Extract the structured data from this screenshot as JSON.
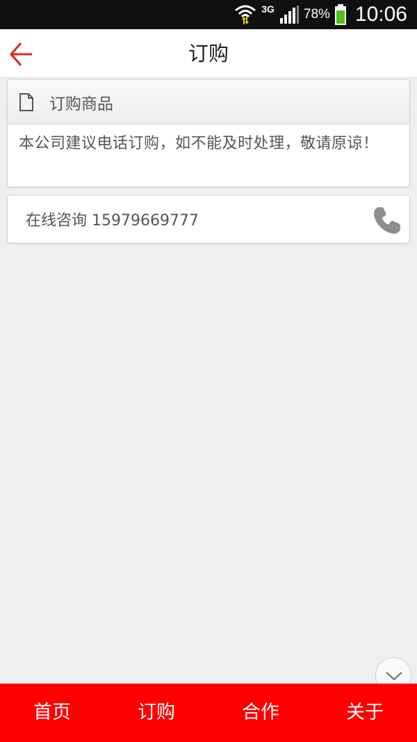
{
  "status_bar": {
    "network": "3G",
    "battery": "78%",
    "time": "10:06",
    "icons": [
      "wifi-icon",
      "signal-icon",
      "battery-icon"
    ]
  },
  "app_bar": {
    "title": "订购",
    "back_icon": "back-arrow-icon",
    "accent_color": "#d9252b"
  },
  "order_card": {
    "header_icon": "document-icon",
    "header_title": "订购商品",
    "body_text": "本公司建议电话订购，如不能及时处理，敬请原谅！"
  },
  "consult_card": {
    "text": "在线咨询 15979669777",
    "icon": "phone-icon"
  },
  "scroll_button_icon": "chevron-down-icon",
  "bottom_nav": {
    "background": "#ff0000",
    "items": [
      {
        "label": "首页"
      },
      {
        "label": "订购"
      },
      {
        "label": "合作"
      },
      {
        "label": "关于"
      }
    ]
  }
}
